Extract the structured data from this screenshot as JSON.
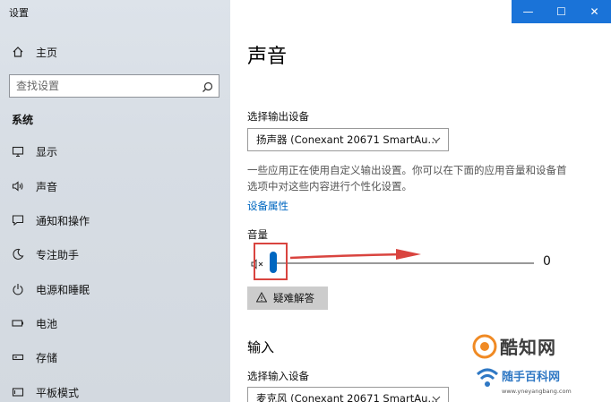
{
  "window": {
    "title": "设置",
    "controls": {
      "minimize": "—",
      "maximize": "☐",
      "close": "✕"
    }
  },
  "sidebar": {
    "home_label": "主页",
    "search_placeholder": "查找设置",
    "section_title": "系统",
    "items": [
      {
        "label": "显示",
        "icon": "monitor-icon"
      },
      {
        "label": "声音",
        "icon": "speaker-icon"
      },
      {
        "label": "通知和操作",
        "icon": "notification-icon"
      },
      {
        "label": "专注助手",
        "icon": "moon-icon"
      },
      {
        "label": "电源和睡眠",
        "icon": "power-icon"
      },
      {
        "label": "电池",
        "icon": "battery-icon"
      },
      {
        "label": "存储",
        "icon": "storage-icon"
      },
      {
        "label": "平板模式",
        "icon": "tablet-icon"
      }
    ]
  },
  "main": {
    "title": "声音",
    "output": {
      "label": "选择输出设备",
      "selected": "扬声器 (Conexant 20671 SmartAu…",
      "description": "一些应用正在使用自定义输出设置。你可以在下面的应用音量和设备首选项中对这些内容进行个性化设置。",
      "properties_link": "设备属性"
    },
    "volume": {
      "label": "音量",
      "value": "0",
      "level": 0
    },
    "troubleshoot_label": "疑难解答",
    "input": {
      "section_title": "输入",
      "label": "选择输入设备",
      "selected": "麦克风 (Conexant 20671 SmartAu…"
    }
  },
  "watermark": {
    "brand": "酷知网",
    "site": "随手百科网",
    "url": "www.yneyangbang.com"
  },
  "colors": {
    "accent": "#0067c0",
    "highlight": "#d9443f",
    "titlebar": "#1a73d8"
  }
}
